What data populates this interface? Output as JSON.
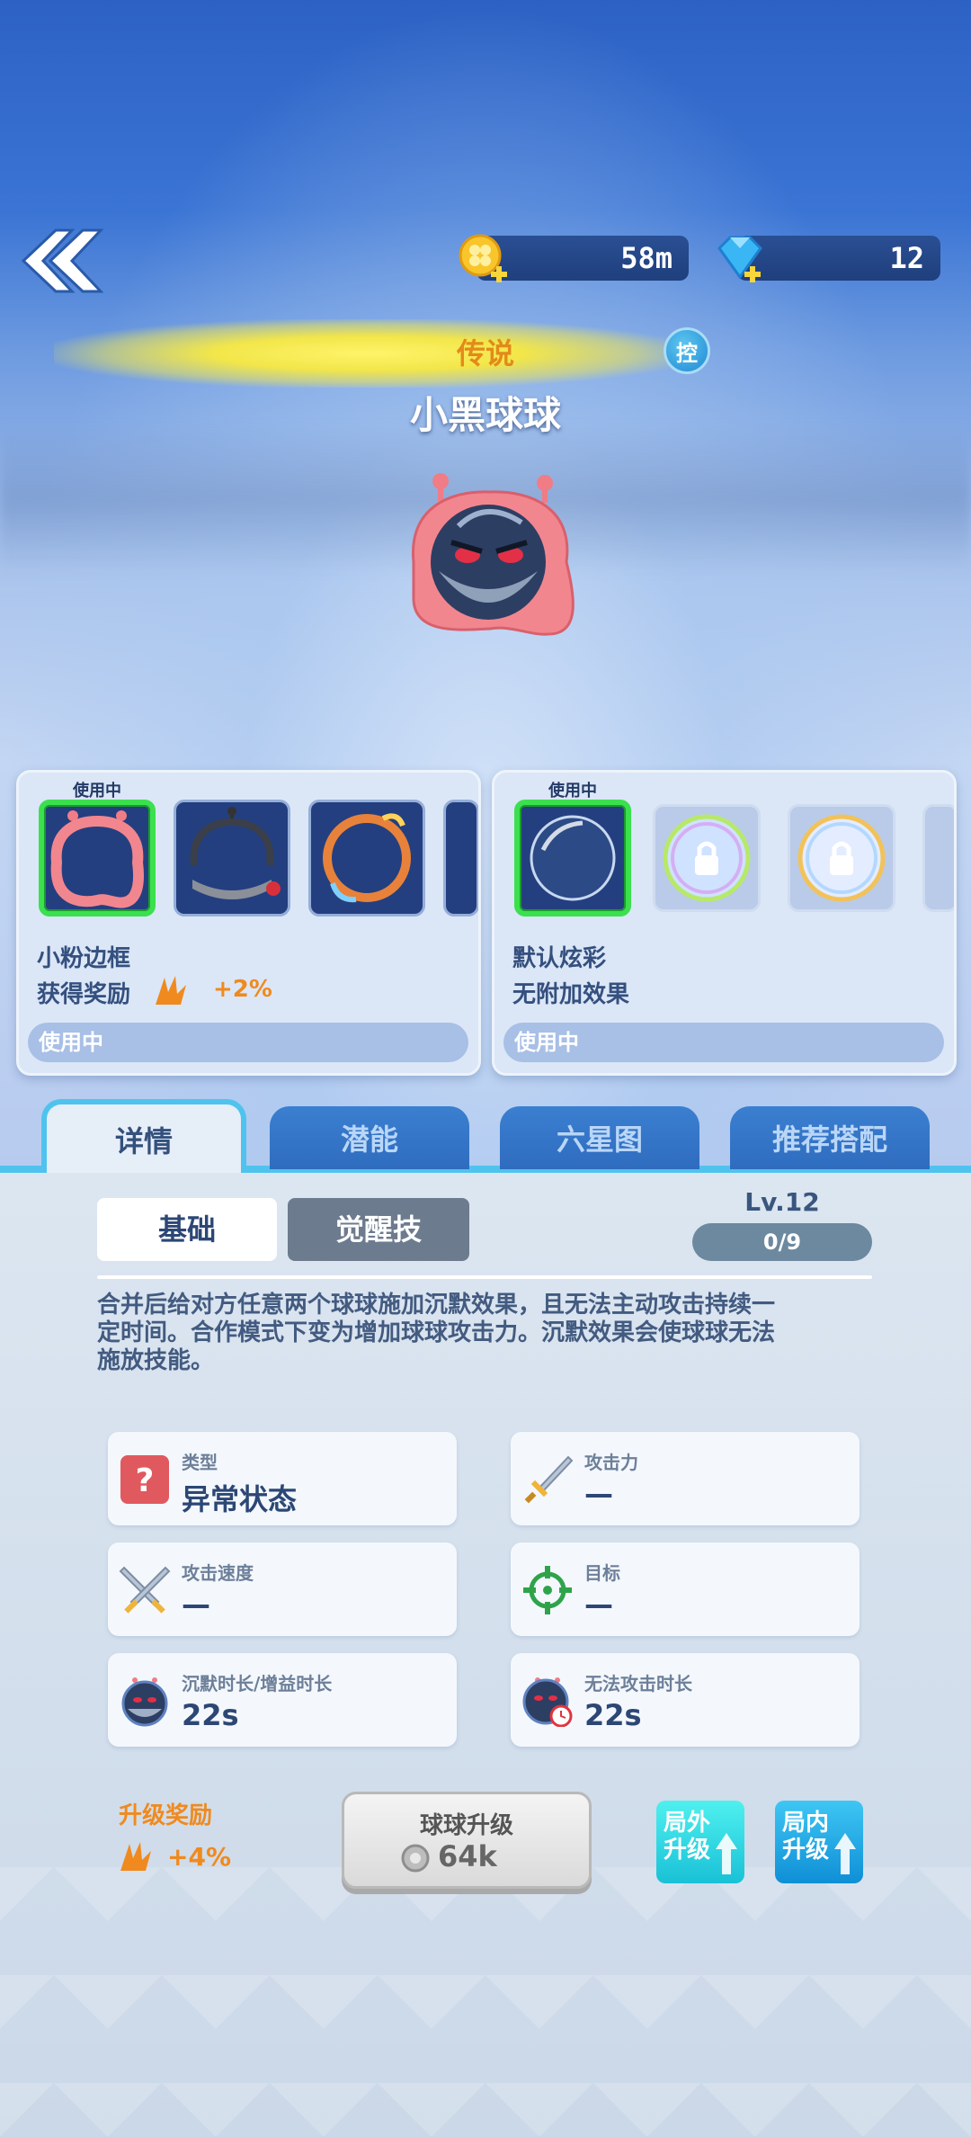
{
  "header": {
    "gold": "58m",
    "gems": "12"
  },
  "hero": {
    "rarity": "传说",
    "badge": "控",
    "name": "小黑球球"
  },
  "frame_card": {
    "in_use_tag": "使用中",
    "title": "小粉边框",
    "reward_label": "获得奖励",
    "reward_value": "+2%",
    "status": "使用中"
  },
  "effect_card": {
    "in_use_tag": "使用中",
    "title": "默认炫彩",
    "subtitle": "无附加效果",
    "status": "使用中"
  },
  "tabs": [
    {
      "label": "详情"
    },
    {
      "label": "潜能"
    },
    {
      "label": "六星图"
    },
    {
      "label": "推荐搭配"
    }
  ],
  "detail": {
    "seg_basic": "基础",
    "seg_awaken": "觉醒技",
    "level": "Lv.12",
    "progress": "0/9",
    "description": "合并后给对方任意两个球球施加沉默效果，且无法主动攻击持续一定时间。合作模式下变为增加球球攻击力。沉默效果会使球球无法施放技能。"
  },
  "stats": [
    {
      "label": "类型",
      "value": "异常状态",
      "icon": "question-icon"
    },
    {
      "label": "攻击力",
      "value": "—",
      "icon": "sword-icon"
    },
    {
      "label": "攻击速度",
      "value": "—",
      "icon": "crossed-swords-icon"
    },
    {
      "label": "目标",
      "value": "—",
      "icon": "crosshair-icon"
    },
    {
      "label": "沉默时长/增益时长",
      "value": "22s",
      "icon": "black-ball-icon"
    },
    {
      "label": "无法攻击时长",
      "value": "22s",
      "icon": "black-ball-clock-icon"
    }
  ],
  "upgrade": {
    "reward_label": "升级奖励",
    "reward_value": "+4%",
    "button_title": "球球升级",
    "cost": "64k",
    "outside_label": "局外升级",
    "inside_label": "局内升级"
  },
  "colors": {
    "accent": "#4fc3ee",
    "orange": "#f08a1e",
    "selected_green": "#3be04e"
  }
}
